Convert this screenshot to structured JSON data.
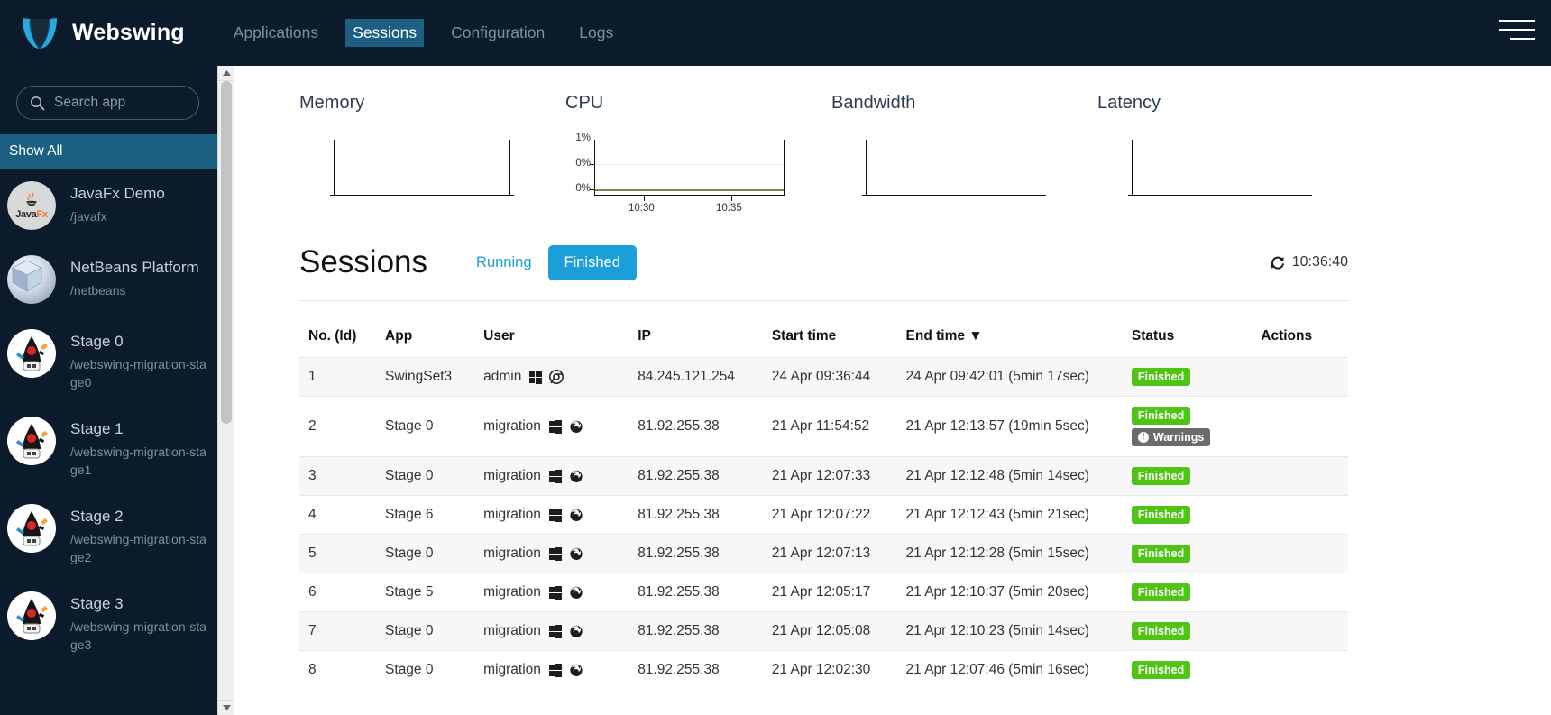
{
  "navbar": {
    "brand": "Webswing",
    "logo_icon": "webswing-logo-icon",
    "menu_icon": "hamburger-menu-icon",
    "items": [
      {
        "label": "Applications",
        "active": false
      },
      {
        "label": "Sessions",
        "active": true
      },
      {
        "label": "Configuration",
        "active": false
      },
      {
        "label": "Logs",
        "active": false
      }
    ]
  },
  "sidebar": {
    "search": {
      "placeholder": "Search app",
      "value": "",
      "icon": "search-icon"
    },
    "show_all": "Show All",
    "apps": [
      {
        "name": "JavaFx Demo",
        "path": "/javafx",
        "icon": "javafx-icon"
      },
      {
        "name": "NetBeans Platform",
        "path": "/netbeans",
        "icon": "netbeans-icon"
      },
      {
        "name": "Stage 0",
        "path": "/webswing-migration-stage0",
        "icon": "duke-icon"
      },
      {
        "name": "Stage 1",
        "path": "/webswing-migration-stage1",
        "icon": "duke-icon"
      },
      {
        "name": "Stage 2",
        "path": "/webswing-migration-stage2",
        "icon": "duke-icon"
      },
      {
        "name": "Stage 3",
        "path": "/webswing-migration-stage3",
        "icon": "duke-icon"
      }
    ]
  },
  "charts": [
    {
      "title": "Memory",
      "y_labels": [],
      "x_labels": []
    },
    {
      "title": "CPU",
      "y_labels": [
        "1%",
        "0%",
        "0%"
      ],
      "x_labels": [
        "10:30",
        "10:35"
      ]
    },
    {
      "title": "Bandwidth",
      "y_labels": [],
      "x_labels": []
    },
    {
      "title": "Latency",
      "y_labels": [],
      "x_labels": []
    }
  ],
  "chart_data": {
    "type": "line",
    "title": "CPU",
    "xlabel": "",
    "ylabel": "",
    "x": [
      "10:30",
      "10:35"
    ],
    "series": [
      {
        "name": "CPU",
        "values": [
          0,
          0
        ],
        "color": "#7b8a4b"
      }
    ],
    "ylim": [
      0,
      1
    ],
    "y_ticks": [
      "0%",
      "0%",
      "1%"
    ],
    "grid": true,
    "legend": "none",
    "panels": [
      "Memory",
      "CPU",
      "Bandwidth",
      "Latency"
    ]
  },
  "sessions": {
    "title": "Sessions",
    "tabs": [
      {
        "label": "Running",
        "active": false
      },
      {
        "label": "Finished",
        "active": true
      }
    ],
    "refresh": {
      "icon": "refresh-icon",
      "time": "10:36:40"
    },
    "columns": [
      "No. (Id)",
      "App",
      "User",
      "IP",
      "Start time",
      "End time ▼",
      "Status",
      "Actions"
    ],
    "sort_column": "End time",
    "sort_direction": "desc",
    "rows": [
      {
        "no": "1",
        "app": "SwingSet3",
        "user": "admin",
        "os_icon": "windows-icon",
        "browser_icon": "chrome-icon",
        "ip": "84.245.121.254",
        "start": "24 Apr 09:36:44",
        "end": "24 Apr 09:42:01 (5min 17sec)",
        "status": "Finished",
        "warnings": null,
        "actions": ""
      },
      {
        "no": "2",
        "app": "Stage 0",
        "user": "migration",
        "os_icon": "windows-icon",
        "browser_icon": "firefox-icon",
        "ip": "81.92.255.38",
        "start": "21 Apr 11:54:52",
        "end": "21 Apr 12:13:57 (19min 5sec)",
        "status": "Finished",
        "warnings": "Warnings",
        "actions": ""
      },
      {
        "no": "3",
        "app": "Stage 0",
        "user": "migration",
        "os_icon": "windows-icon",
        "browser_icon": "firefox-icon",
        "ip": "81.92.255.38",
        "start": "21 Apr 12:07:33",
        "end": "21 Apr 12:12:48 (5min 14sec)",
        "status": "Finished",
        "warnings": null,
        "actions": ""
      },
      {
        "no": "4",
        "app": "Stage 6",
        "user": "migration",
        "os_icon": "windows-icon",
        "browser_icon": "firefox-icon",
        "ip": "81.92.255.38",
        "start": "21 Apr 12:07:22",
        "end": "21 Apr 12:12:43 (5min 21sec)",
        "status": "Finished",
        "warnings": null,
        "actions": ""
      },
      {
        "no": "5",
        "app": "Stage 0",
        "user": "migration",
        "os_icon": "windows-icon",
        "browser_icon": "firefox-icon",
        "ip": "81.92.255.38",
        "start": "21 Apr 12:07:13",
        "end": "21 Apr 12:12:28 (5min 15sec)",
        "status": "Finished",
        "warnings": null,
        "actions": ""
      },
      {
        "no": "6",
        "app": "Stage 5",
        "user": "migration",
        "os_icon": "windows-icon",
        "browser_icon": "firefox-icon",
        "ip": "81.92.255.38",
        "start": "21 Apr 12:05:17",
        "end": "21 Apr 12:10:37 (5min 20sec)",
        "status": "Finished",
        "warnings": null,
        "actions": ""
      },
      {
        "no": "7",
        "app": "Stage 0",
        "user": "migration",
        "os_icon": "windows-icon",
        "browser_icon": "firefox-icon",
        "ip": "81.92.255.38",
        "start": "21 Apr 12:05:08",
        "end": "21 Apr 12:10:23 (5min 14sec)",
        "status": "Finished",
        "warnings": null,
        "actions": ""
      },
      {
        "no": "8",
        "app": "Stage 0",
        "user": "migration",
        "os_icon": "windows-icon",
        "browser_icon": "firefox-icon",
        "ip": "81.92.255.38",
        "start": "21 Apr 12:02:30",
        "end": "21 Apr 12:07:46 (5min 16sec)",
        "status": "Finished",
        "warnings": null,
        "actions": ""
      }
    ]
  },
  "colors": {
    "navbar_bg": "#0b1b2b",
    "accent": "#1b9fd8",
    "active_nav_bg": "#1d5f82",
    "show_all_bg": "#1a5f80",
    "badge_green": "#4fc414",
    "badge_gray": "#6b6b6b",
    "cpu_line": "#7b8a4b"
  }
}
